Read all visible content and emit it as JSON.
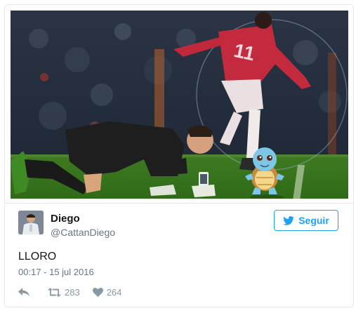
{
  "tweet": {
    "author_name": "Diego",
    "author_handle": "@CattanDiego",
    "text": "LLORO",
    "timestamp": "00:17 - 15 jul 2016",
    "retweets": "283",
    "likes": "264"
  },
  "follow_button": {
    "label": "Seguir"
  },
  "player_number": "11",
  "colors": {
    "accent": "#1da1f2",
    "text": "#14171a",
    "muted": "#657786",
    "action": "#8899a6",
    "border": "#e1e8ed"
  },
  "icons": [
    "twitter-bird-icon",
    "reply-icon",
    "retweet-icon",
    "heart-icon"
  ]
}
